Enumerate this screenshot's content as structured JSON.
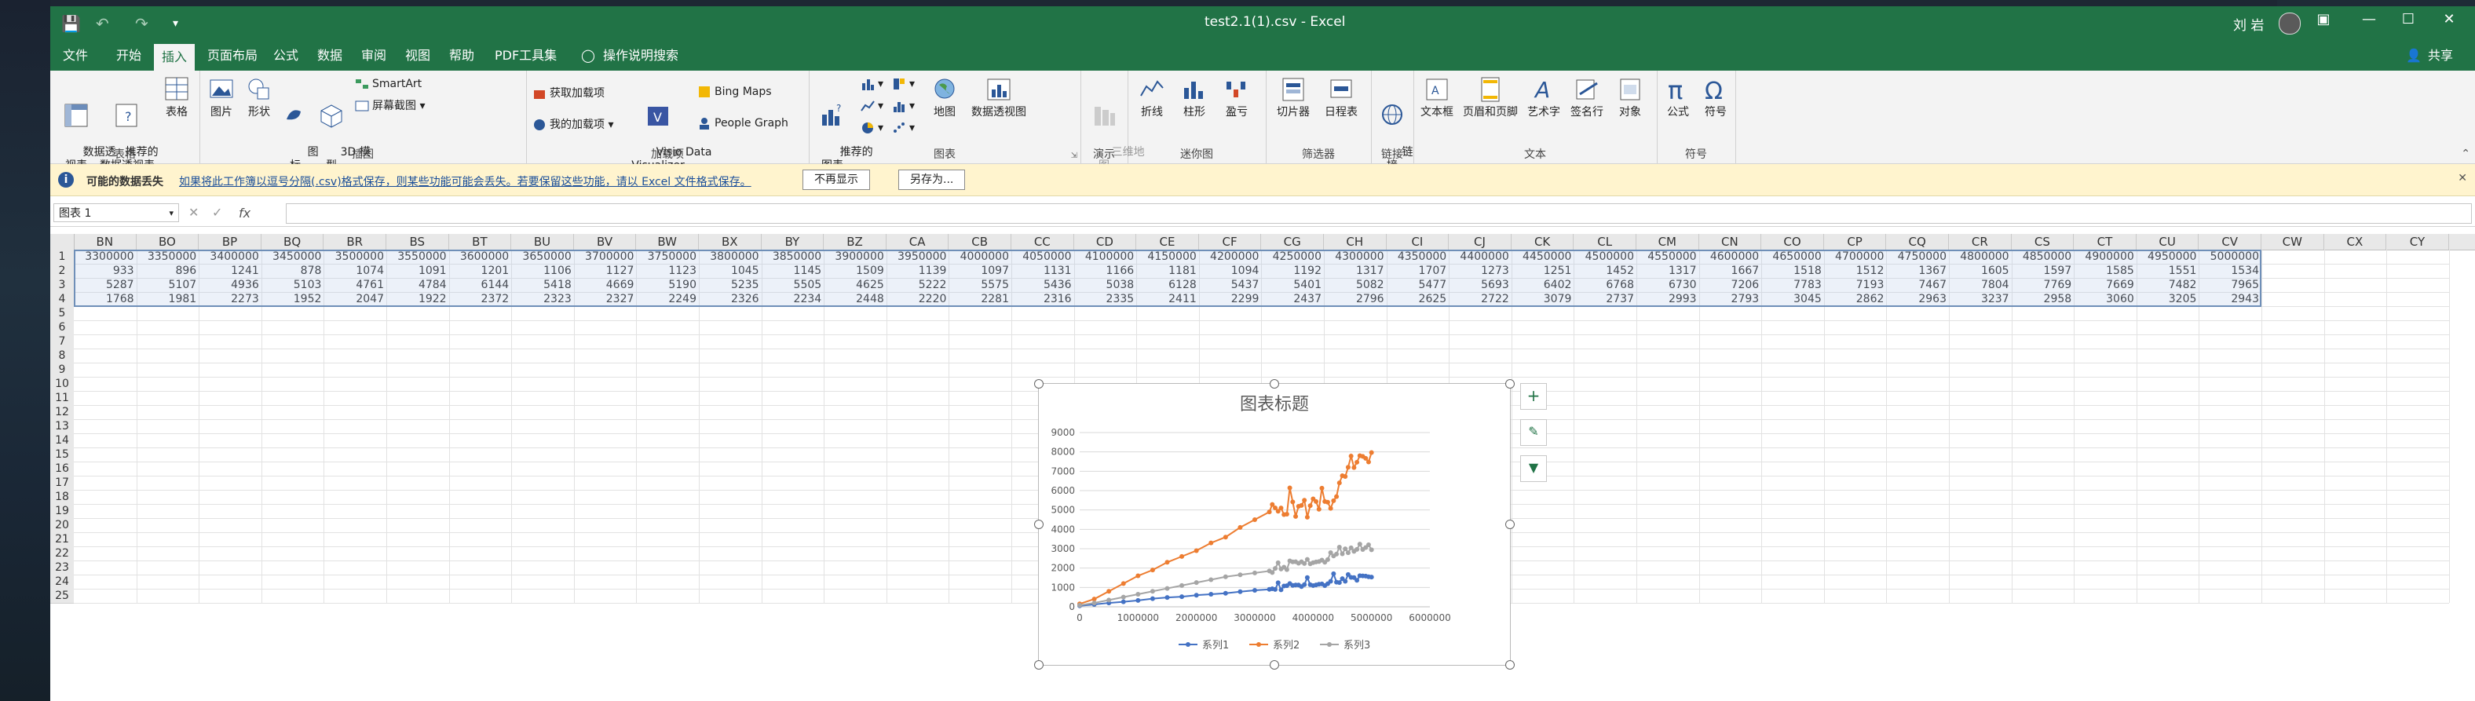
{
  "window": {
    "title": "test2.1(1).csv  -  Excel",
    "user": "刘 岩",
    "share": "共享"
  },
  "tabs": [
    "文件",
    "开始",
    "插入",
    "页面布局",
    "公式",
    "数据",
    "审阅",
    "视图",
    "帮助",
    "PDF工具集",
    "操作说明搜索"
  ],
  "ribbon": {
    "groups": {
      "table": "表格",
      "illustrations": "插图",
      "addins": "加载项",
      "charts": "图表",
      "tours": "演示",
      "sparklines": "迷你图",
      "filters": "筛选器",
      "links": "链接",
      "text": "文本",
      "symbols": "符号"
    },
    "buttons": {
      "pivot": "数据透\n视表",
      "rec_pivot": "推荐的\n数据透视表",
      "table": "表格",
      "picture": "图片",
      "shapes": "形状",
      "icons": "图\n标",
      "model3d": "3D 模\n型",
      "smartart": "SmartArt",
      "screenshot": "屏幕截图",
      "get_addins": "获取加载项",
      "my_addins": "我的加载项",
      "visio": "Visio Data\nVisualizer",
      "bing": "Bing Maps",
      "people": "People Graph",
      "rec_charts": "推荐的\n图表",
      "maps": "地图",
      "pivot_chart": "数据透视图",
      "map3d": "三维地\n图",
      "line": "折线",
      "column": "柱形",
      "winloss": "盈亏",
      "slicer": "切片器",
      "timeline": "日程表",
      "link": "链\n接",
      "textbox": "文本框",
      "headerfooter": "页眉和页脚",
      "wordart": "艺术字",
      "signature": "签名行",
      "object": "对象",
      "equation": "公式",
      "symbol": "符号"
    }
  },
  "infobar": {
    "title": "可能的数据丢失",
    "message": "如果将此工作簿以逗号分隔(.csv)格式保存，则某些功能可能会丢失。若要保留这些功能，请以 Excel 文件格式保存。",
    "btn_dismiss": "不再显示",
    "btn_saveas": "另存为..."
  },
  "formula_bar": {
    "name_box": "图表 1",
    "fx": "fx",
    "value": ""
  },
  "sheet": {
    "columns": [
      "BN",
      "BO",
      "BP",
      "BQ",
      "BR",
      "BS",
      "BT",
      "BU",
      "BV",
      "BW",
      "BX",
      "BY",
      "BZ",
      "CA",
      "CB",
      "CC",
      "CD",
      "CE",
      "CF",
      "CG",
      "CH",
      "CI",
      "CJ",
      "CK",
      "CL",
      "CM",
      "CN",
      "CO",
      "CP",
      "CQ",
      "CR",
      "CS",
      "CT",
      "CU",
      "CV",
      "CW",
      "CX",
      "CY"
    ],
    "rows": [
      [
        "3300000",
        "3350000",
        "3400000",
        "3450000",
        "3500000",
        "3550000",
        "3600000",
        "3650000",
        "3700000",
        "3750000",
        "3800000",
        "3850000",
        "3900000",
        "3950000",
        "4000000",
        "4050000",
        "4100000",
        "4150000",
        "4200000",
        "4250000",
        "4300000",
        "4350000",
        "4400000",
        "4450000",
        "4500000",
        "4550000",
        "4600000",
        "4650000",
        "4700000",
        "4750000",
        "4800000",
        "4850000",
        "4900000",
        "4950000",
        "5000000"
      ],
      [
        "933",
        "896",
        "1241",
        "878",
        "1074",
        "1091",
        "1201",
        "1106",
        "1127",
        "1123",
        "1045",
        "1145",
        "1509",
        "1139",
        "1097",
        "1131",
        "1166",
        "1181",
        "1094",
        "1192",
        "1317",
        "1707",
        "1273",
        "1251",
        "1452",
        "1317",
        "1667",
        "1518",
        "1512",
        "1367",
        "1605",
        "1597",
        "1585",
        "1551",
        "1534"
      ],
      [
        "5287",
        "5107",
        "4936",
        "5103",
        "4761",
        "4784",
        "6144",
        "5418",
        "4669",
        "5190",
        "5235",
        "5505",
        "4625",
        "5222",
        "5575",
        "5436",
        "5038",
        "6128",
        "5437",
        "5401",
        "5082",
        "5477",
        "5693",
        "6402",
        "6768",
        "6730",
        "7206",
        "7783",
        "7193",
        "7467",
        "7804",
        "7769",
        "7669",
        "7482",
        "7965"
      ],
      [
        "1768",
        "1981",
        "2273",
        "1952",
        "2047",
        "1922",
        "2372",
        "2323",
        "2327",
        "2249",
        "2326",
        "2234",
        "2448",
        "2220",
        "2281",
        "2316",
        "2335",
        "2411",
        "2299",
        "2437",
        "2796",
        "2625",
        "2722",
        "3079",
        "2737",
        "2993",
        "2793",
        "3045",
        "2862",
        "2963",
        "3237",
        "2958",
        "3060",
        "3205",
        "2943"
      ]
    ],
    "row_numbers": [
      "1",
      "2",
      "3",
      "4",
      "5",
      "6",
      "7",
      "8",
      "9",
      "10",
      "11",
      "12",
      "13",
      "14",
      "15",
      "16",
      "17",
      "18",
      "19",
      "20",
      "21",
      "22",
      "23",
      "24",
      "25"
    ]
  },
  "chart_data": {
    "type": "line",
    "title": "图表标题",
    "xlim": [
      0,
      6000000
    ],
    "ylim": [
      0,
      9000
    ],
    "x_ticks": [
      "0",
      "1000000",
      "2000000",
      "3000000",
      "4000000",
      "5000000",
      "6000000"
    ],
    "y_ticks": [
      "0",
      "1000",
      "2000",
      "3000",
      "4000",
      "5000",
      "6000",
      "7000",
      "8000",
      "9000"
    ],
    "legend_position": "bottom",
    "colors": {
      "系列1": "#4472c4",
      "系列2": "#ed7d31",
      "系列3": "#a5a5a5"
    },
    "series": [
      {
        "name": "系列1",
        "x": [
          0,
          250000,
          500000,
          750000,
          1000000,
          1250000,
          1500000,
          1750000,
          2000000,
          2250000,
          2500000,
          2750000,
          3000000,
          3250000,
          3300000,
          3350000,
          3400000,
          3450000,
          3500000,
          3550000,
          3600000,
          3650000,
          3700000,
          3750000,
          3800000,
          3850000,
          3900000,
          3950000,
          4000000,
          4050000,
          4100000,
          4150000,
          4200000,
          4250000,
          4300000,
          4350000,
          4400000,
          4450000,
          4500000,
          4550000,
          4600000,
          4650000,
          4700000,
          4750000,
          4800000,
          4850000,
          4900000,
          4950000,
          5000000
        ],
        "values": [
          50,
          120,
          200,
          260,
          330,
          420,
          480,
          520,
          600,
          650,
          700,
          780,
          850,
          900,
          933,
          896,
          1241,
          878,
          1074,
          1091,
          1201,
          1106,
          1127,
          1123,
          1045,
          1145,
          1509,
          1139,
          1097,
          1131,
          1166,
          1181,
          1094,
          1192,
          1317,
          1707,
          1273,
          1251,
          1452,
          1317,
          1667,
          1518,
          1512,
          1367,
          1605,
          1597,
          1585,
          1551,
          1534
        ]
      },
      {
        "name": "系列2",
        "x": [
          0,
          250000,
          500000,
          750000,
          1000000,
          1250000,
          1500000,
          1750000,
          2000000,
          2250000,
          2500000,
          2750000,
          3000000,
          3250000,
          3300000,
          3350000,
          3400000,
          3450000,
          3500000,
          3550000,
          3600000,
          3650000,
          3700000,
          3750000,
          3800000,
          3850000,
          3900000,
          3950000,
          4000000,
          4050000,
          4100000,
          4150000,
          4200000,
          4250000,
          4300000,
          4350000,
          4400000,
          4450000,
          4500000,
          4550000,
          4600000,
          4650000,
          4700000,
          4750000,
          4800000,
          4850000,
          4900000,
          4950000,
          5000000
        ],
        "values": [
          150,
          400,
          800,
          1200,
          1600,
          1900,
          2300,
          2600,
          2900,
          3300,
          3600,
          4100,
          4500,
          4900,
          5287,
          5107,
          4936,
          5103,
          4761,
          4784,
          6144,
          5418,
          4669,
          5190,
          5235,
          5505,
          4625,
          5222,
          5575,
          5436,
          5038,
          6128,
          5437,
          5401,
          5082,
          5477,
          5693,
          6402,
          6768,
          6730,
          7206,
          7783,
          7193,
          7467,
          7804,
          7769,
          7669,
          7482,
          7965
        ]
      },
      {
        "name": "系列3",
        "x": [
          0,
          250000,
          500000,
          750000,
          1000000,
          1250000,
          1500000,
          1750000,
          2000000,
          2250000,
          2500000,
          2750000,
          3000000,
          3250000,
          3300000,
          3350000,
          3400000,
          3450000,
          3500000,
          3550000,
          3600000,
          3650000,
          3700000,
          3750000,
          3800000,
          3850000,
          3900000,
          3950000,
          4000000,
          4050000,
          4100000,
          4150000,
          4200000,
          4250000,
          4300000,
          4350000,
          4400000,
          4450000,
          4500000,
          4550000,
          4600000,
          4650000,
          4700000,
          4750000,
          4800000,
          4850000,
          4900000,
          4950000,
          5000000
        ],
        "values": [
          80,
          200,
          350,
          500,
          650,
          800,
          950,
          1100,
          1250,
          1400,
          1550,
          1650,
          1750,
          1850,
          1768,
          1981,
          2273,
          1952,
          2047,
          1922,
          2372,
          2323,
          2327,
          2249,
          2326,
          2234,
          2448,
          2220,
          2281,
          2316,
          2335,
          2411,
          2299,
          2437,
          2796,
          2625,
          2722,
          3079,
          2737,
          2993,
          2793,
          3045,
          2862,
          2963,
          3237,
          2958,
          3060,
          3205,
          2943
        ]
      }
    ]
  }
}
